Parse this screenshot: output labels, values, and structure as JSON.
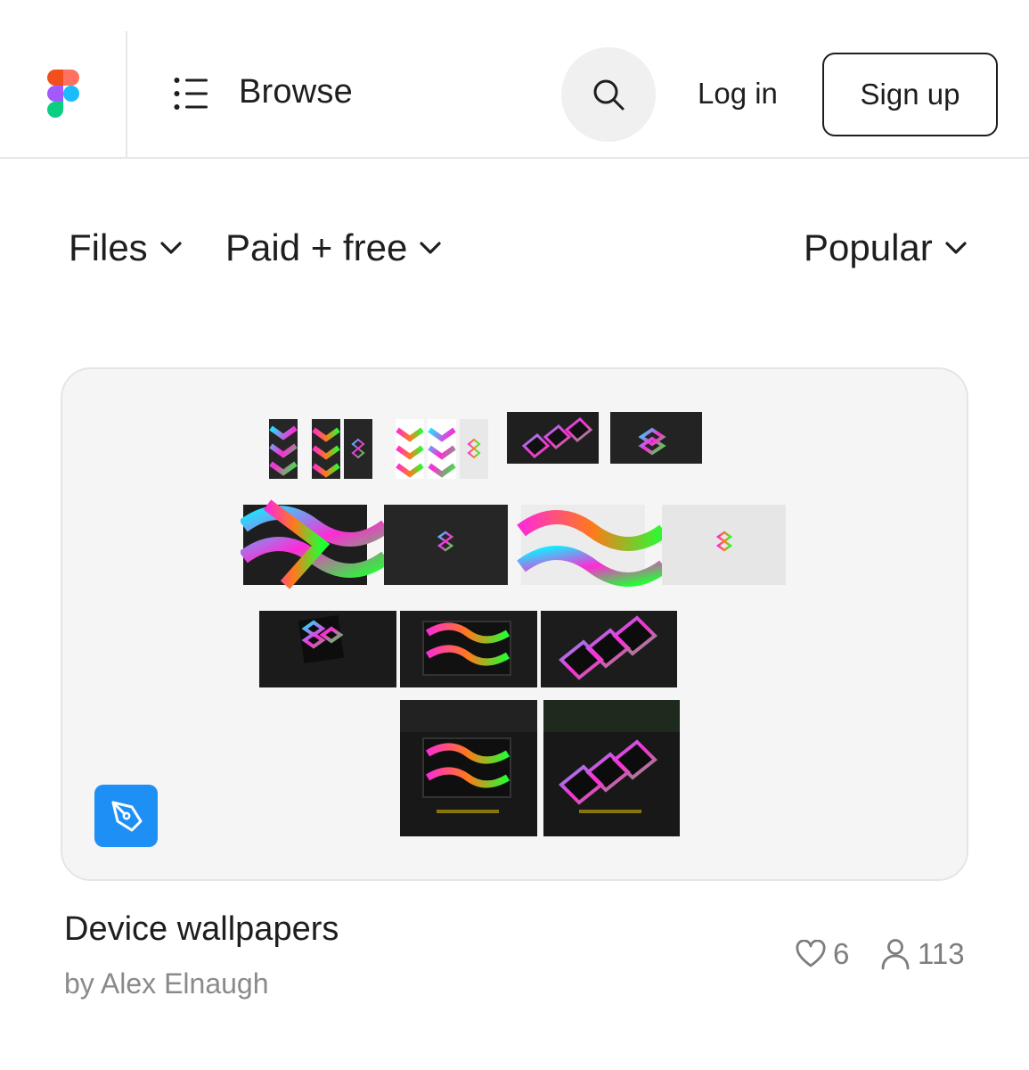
{
  "header": {
    "nav_label": "Browse",
    "login_label": "Log in",
    "signup_label": "Sign up",
    "icons": {
      "logo": "figma-logo",
      "menu": "list-icon",
      "search": "search-icon"
    }
  },
  "filters": {
    "type": "Files",
    "price": "Paid + free",
    "sort": "Popular"
  },
  "card": {
    "title": "Device wallpapers",
    "author": "by Alex Elnaugh",
    "likes": "6",
    "users": "113",
    "badge_icon": "pen-tool-icon"
  },
  "colors": {
    "accent_blue": "#1e90f5",
    "text": "#1e1e1e",
    "muted": "#8a8a8a",
    "card_bg": "#f5f5f5",
    "art_magenta": "#ff2bd6",
    "art_green": "#22ff33",
    "art_cyan": "#18e8ff",
    "art_dark": "#2a2a2a"
  }
}
